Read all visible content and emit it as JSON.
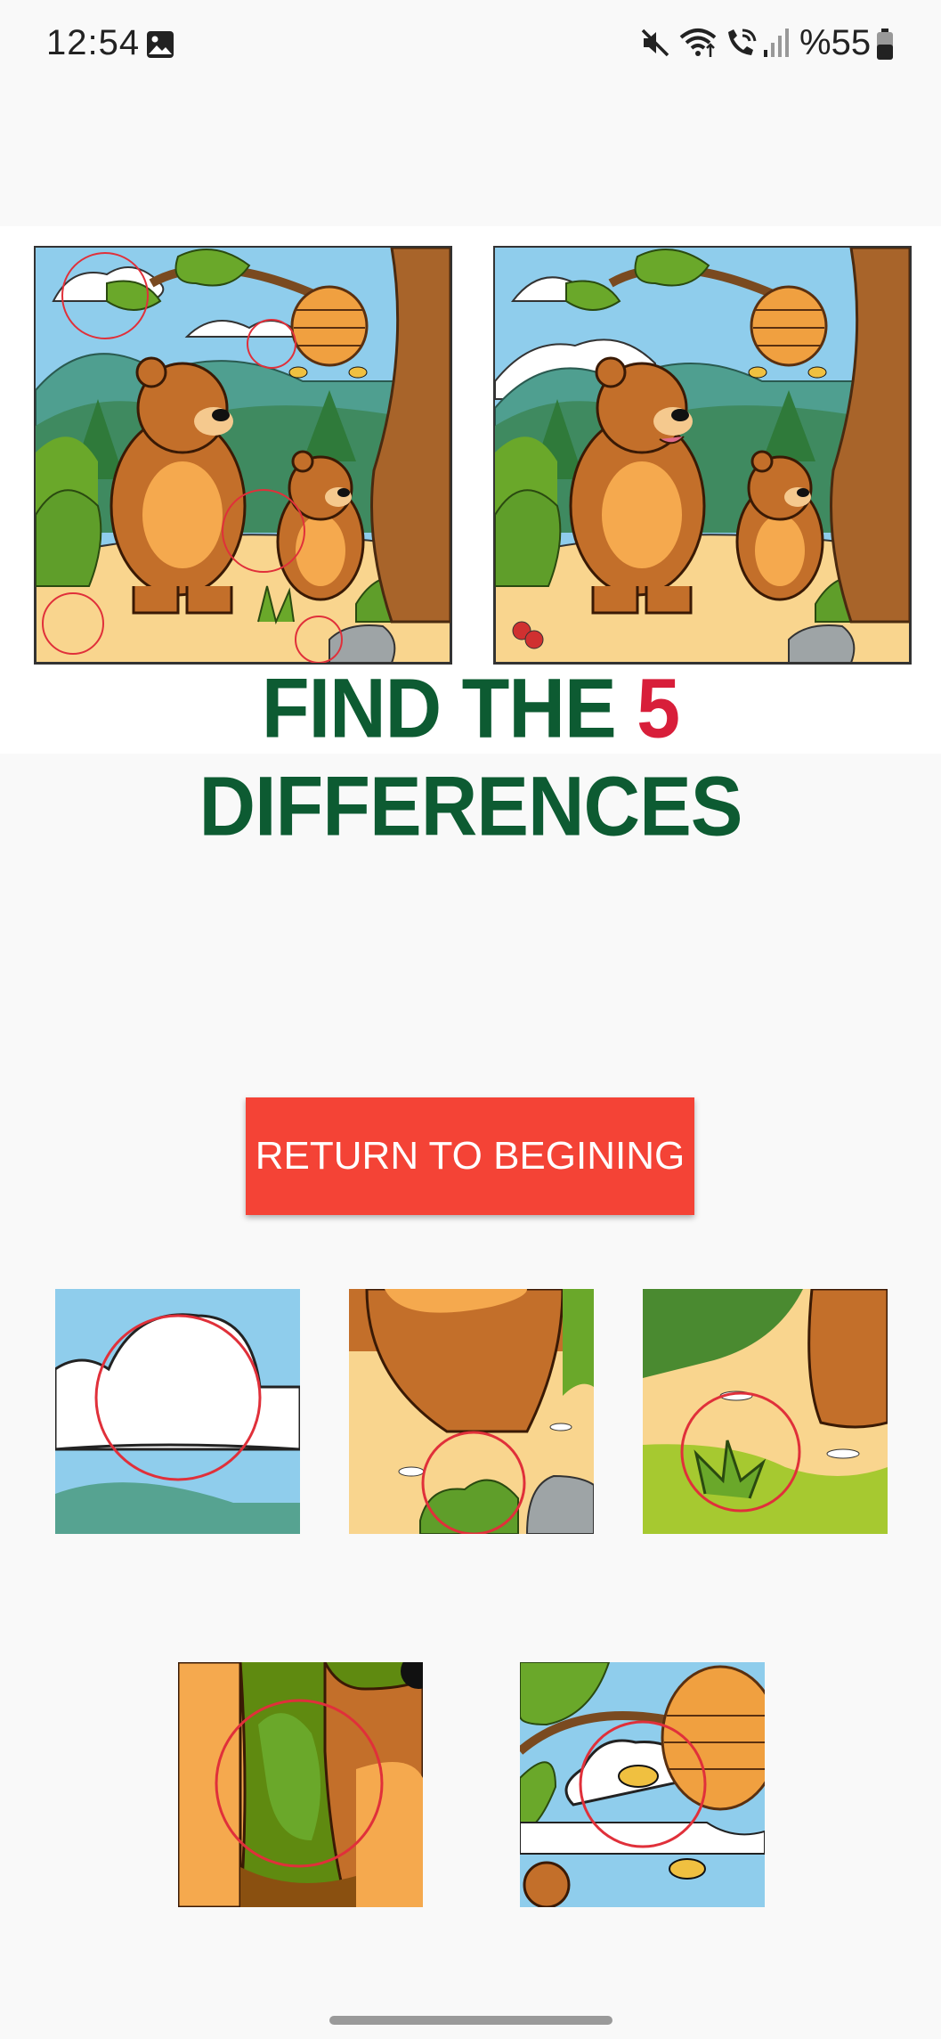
{
  "status_bar": {
    "time": "12:54",
    "battery": "%55",
    "icons": [
      "gallery-icon",
      "mute-icon",
      "wifi-icon",
      "wifi-call-icon",
      "signal-icon",
      "battery-icon"
    ]
  },
  "puzzle": {
    "title_prefix": "FIND THE ",
    "title_number": "5",
    "title_suffix": " DIFFERENCES",
    "colors": {
      "title": "#0d5b32",
      "number": "#d81e3a",
      "circle": "#e0303a"
    }
  },
  "return_button": {
    "label": "RETURN TO BEGINING",
    "color": "#f44336"
  },
  "differences_found": 5
}
